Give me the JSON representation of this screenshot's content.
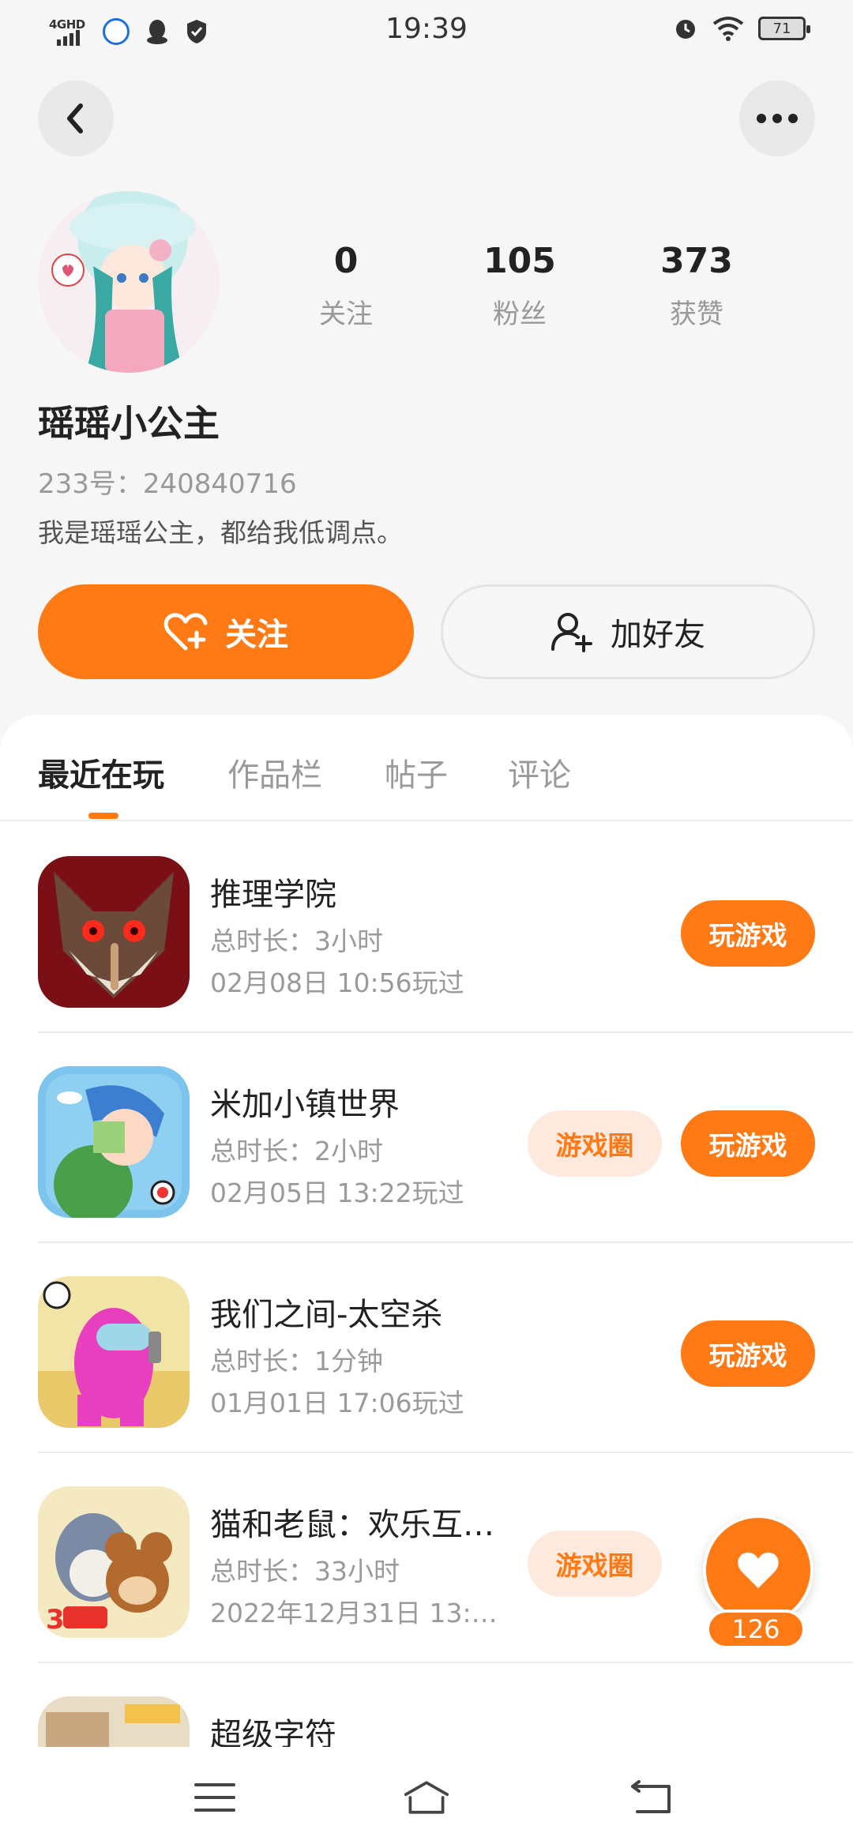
{
  "status_bar": {
    "network": "4GHD",
    "time": "19:39",
    "battery": "71"
  },
  "header": {
    "back_icon": "chevron-left-icon",
    "more_icon": "more-dots-icon"
  },
  "profile": {
    "stats": [
      {
        "value": "0",
        "label": "关注"
      },
      {
        "value": "105",
        "label": "粉丝"
      },
      {
        "value": "373",
        "label": "获赞"
      }
    ],
    "name": "瑶瑶小公主",
    "id_text": "233号：240840716",
    "bio": "我是瑶瑶公主，都给我低调点。",
    "follow_label": "关注",
    "add_friend_label": "加好友"
  },
  "tabs": [
    {
      "label": "最近在玩",
      "active": true
    },
    {
      "label": "作品栏",
      "active": false
    },
    {
      "label": "帖子",
      "active": false
    },
    {
      "label": "评论",
      "active": false
    }
  ],
  "games": [
    {
      "title": "推理学院",
      "duration": "总时长：3小时",
      "last_played": "02月08日 10:56玩过",
      "circle_label": "",
      "play_label": "玩游戏"
    },
    {
      "title": "米加小镇世界",
      "duration": "总时长：2小时",
      "last_played": "02月05日 13:22玩过",
      "circle_label": "游戏圈",
      "play_label": "玩游戏"
    },
    {
      "title": "我们之间-太空杀",
      "duration": "总时长：1分钟",
      "last_played": "01月01日 17:06玩过",
      "circle_label": "",
      "play_label": "玩游戏"
    },
    {
      "title": "猫和老鼠：欢乐互…",
      "duration": "总时长：33小时",
      "last_played": "2022年12月31日 13:…",
      "circle_label": "游戏圈",
      "play_label": ""
    },
    {
      "title": "超级字符",
      "duration": "",
      "last_played": "",
      "circle_label": "",
      "play_label": ""
    }
  ],
  "floating_like": {
    "count": "126",
    "icon": "heart-icon"
  },
  "colors": {
    "accent": "#ff7a14",
    "accent_light": "#fde9dd",
    "background": "#f6f6f6"
  }
}
